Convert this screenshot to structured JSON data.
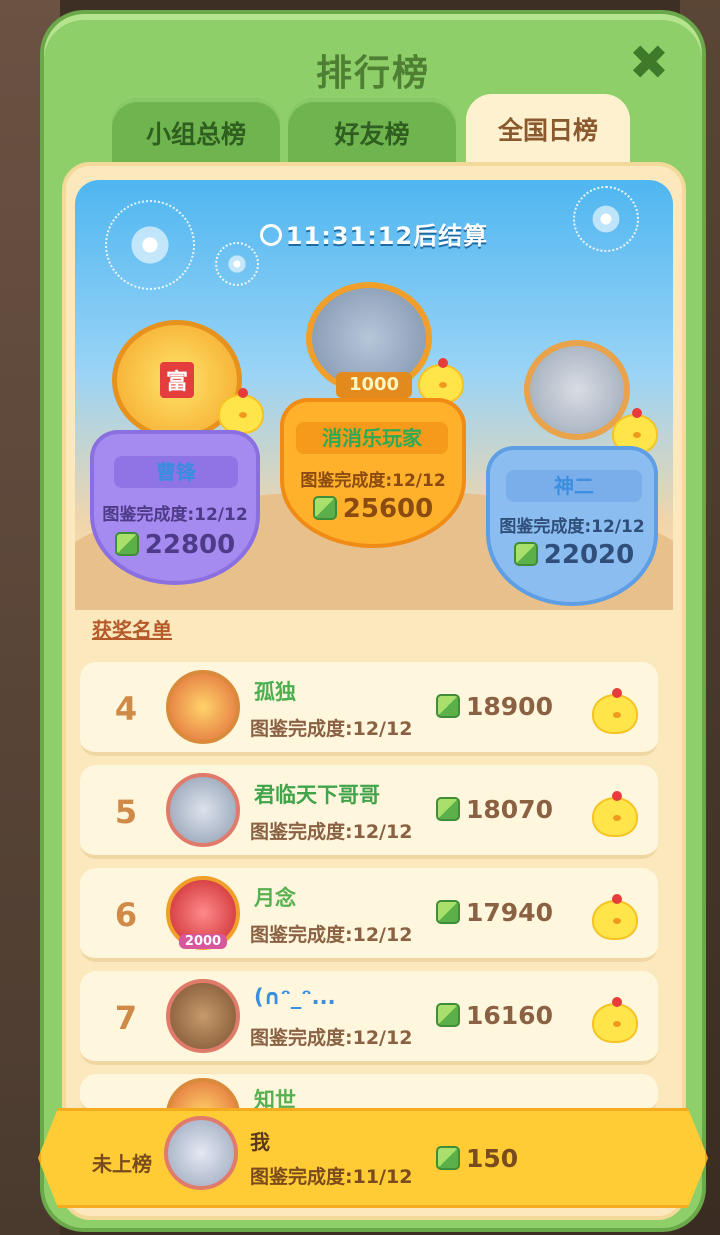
{
  "dialog": {
    "title": "排行榜"
  },
  "tabs": [
    {
      "label": "小组总榜",
      "active": false
    },
    {
      "label": "好友榜",
      "active": false
    },
    {
      "label": "全国日榜",
      "active": true
    }
  ],
  "timer": "11:31:12后结算",
  "podium": {
    "first": {
      "name": "消消乐玩家",
      "completion": "图鉴完成度:12/12",
      "score": "25600",
      "badge": "1000"
    },
    "second": {
      "name": "曹锋",
      "completion": "图鉴完成度:12/12",
      "score": "22800"
    },
    "third": {
      "name": "神二",
      "completion": "图鉴完成度:12/12",
      "score": "22020"
    }
  },
  "awards_label": "获奖名单",
  "rows": [
    {
      "rank": "4",
      "name": "孤独",
      "completion": "图鉴完成度:12/12",
      "score": "18900",
      "name_color": "#4caf50"
    },
    {
      "rank": "5",
      "name": "君临天下哥哥",
      "completion": "图鉴完成度:12/12",
      "score": "18070",
      "name_color": "#3fa44a"
    },
    {
      "rank": "6",
      "name": "月念",
      "completion": "图鉴完成度:12/12",
      "score": "17940",
      "name_color": "#58b050"
    },
    {
      "rank": "7",
      "name": "(∩ᵔ_ᵔ...",
      "completion": "图鉴完成度:12/12",
      "score": "16160",
      "name_color": "#3b8fe0"
    },
    {
      "rank": "",
      "name": "知世",
      "completion": "",
      "score": "",
      "name_color": "#58b050"
    }
  ],
  "me": {
    "label": "未上榜",
    "name": "我",
    "completion": "图鉴完成度:11/12",
    "score": "150"
  },
  "badge_2000": "2000",
  "icons": [
    "close-icon",
    "clock-icon",
    "score-cube-icon",
    "chick-mascot-icon"
  ],
  "colors": {
    "frame_green": "#8fcf6a",
    "panel_cream": "#fbe9bd",
    "gold_bar": "#ffcc35",
    "rank_orange": "#d08a48"
  }
}
